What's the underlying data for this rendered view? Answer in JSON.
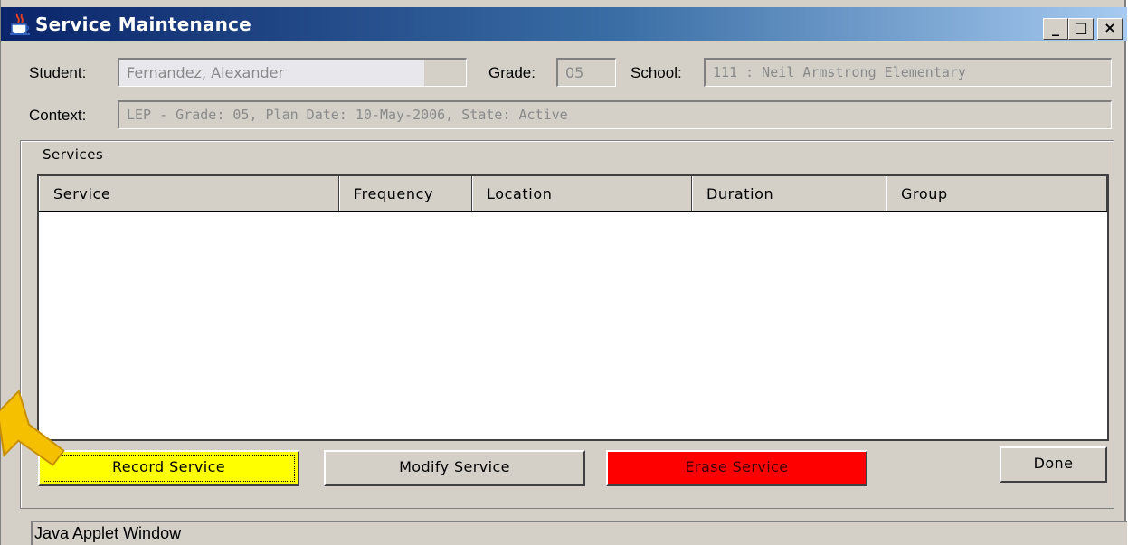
{
  "window": {
    "title": "Service Maintenance",
    "controls": {
      "minimize": "_",
      "maximize": "□",
      "close": "×"
    }
  },
  "header": {
    "student_label": "Student:",
    "student_value": "Fernandez, Alexander",
    "grade_label": "Grade:",
    "grade_value": "05",
    "school_label": "School:",
    "school_value": "111 : Neil Armstrong Elementary",
    "context_label": "Context:",
    "context_value": "LEP -  Grade: 05, Plan Date: 10-May-2006, State: Active"
  },
  "services": {
    "group_title": "Services",
    "columns": [
      "Service",
      "Frequency",
      "Location",
      "Duration",
      "Group"
    ],
    "rows": []
  },
  "buttons": {
    "record": "Record Service",
    "modify": "Modify Service",
    "erase": "Erase Service",
    "done": "Done"
  },
  "status": {
    "text": "Java Applet Window"
  },
  "colors": {
    "record_button": "#ffff00",
    "erase_button": "#ff0000",
    "highlight_arrow": "#f5c000"
  },
  "icons": {
    "title": "java-cup-icon",
    "pointer": "arrow-pointer-icon"
  }
}
